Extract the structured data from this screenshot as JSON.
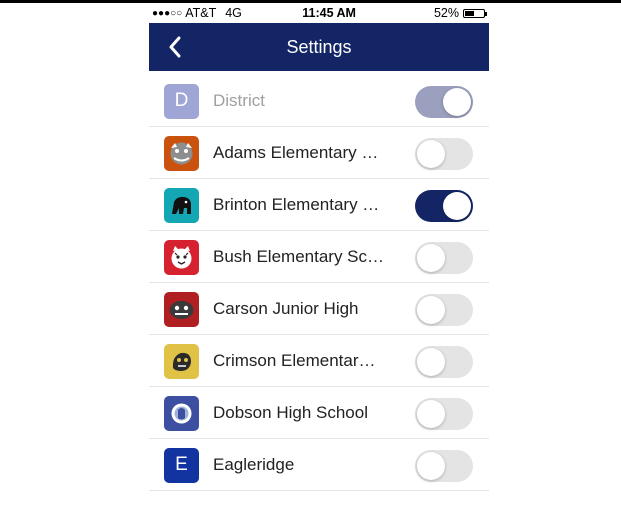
{
  "status_bar": {
    "signal": "●●●○○",
    "carrier": "AT&T",
    "network": "4G",
    "time": "11:45 AM",
    "battery": "52%",
    "battery_level": 0.52
  },
  "nav": {
    "title": "Settings",
    "back_icon": "chevron-left-icon"
  },
  "colors": {
    "nav_bg": "#132565",
    "toggle_on": "#132565",
    "toggle_on_disabled": "#9aa0bd",
    "toggle_off": "#e4e4e4"
  },
  "schools": [
    {
      "name": "District",
      "letter": "D",
      "icon_color": "#9fa6d6",
      "on": true,
      "disabled": true
    },
    {
      "name": "Adams Elementary …",
      "icon": "adams-mascot",
      "icon_color": "#c9520f",
      "on": false,
      "disabled": false
    },
    {
      "name": "Brinton Elementary …",
      "icon": "brinton-mascot",
      "icon_color": "#12a7b3",
      "on": true,
      "disabled": false
    },
    {
      "name": "Bush Elementary Sc…",
      "icon": "bush-mascot",
      "icon_color": "#d62230",
      "on": false,
      "disabled": false
    },
    {
      "name": "Carson Junior High",
      "icon": "carson-mascot",
      "icon_color": "#b01f22",
      "on": false,
      "disabled": false
    },
    {
      "name": "Crimson Elementar…",
      "icon": "crimson-mascot",
      "icon_color": "#e0c247",
      "on": false,
      "disabled": false
    },
    {
      "name": "Dobson High School",
      "icon": "dobson-mascot",
      "icon_color": "#3c4fa0",
      "on": false,
      "disabled": false
    },
    {
      "name": "Eagleridge",
      "letter": "E",
      "icon_color": "#1234a0",
      "on": false,
      "disabled": false
    }
  ]
}
